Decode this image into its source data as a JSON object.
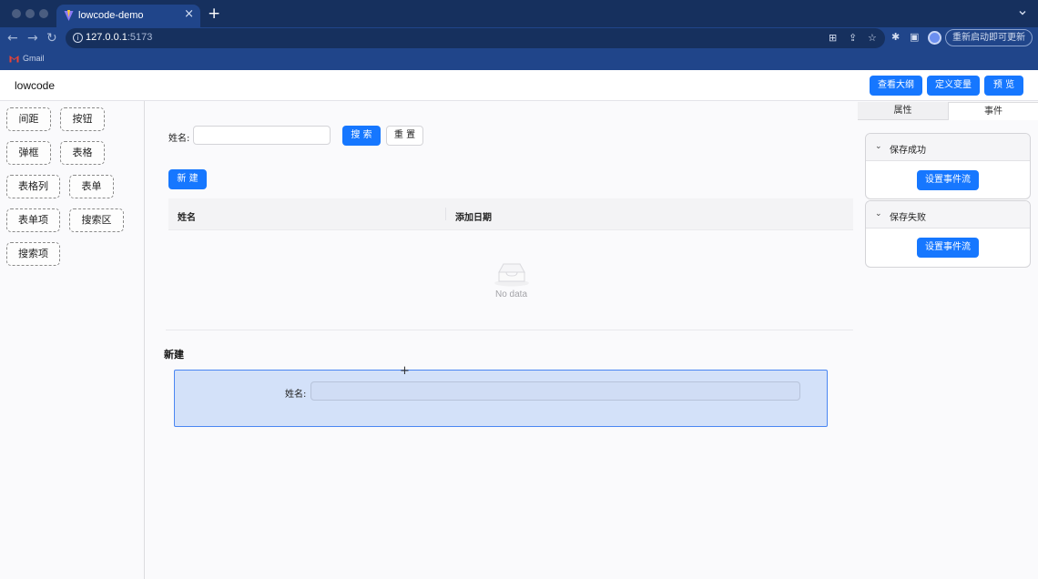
{
  "browser": {
    "tab_title": "lowcode-demo",
    "tab_close": "×",
    "new_tab": "+",
    "url_host": "127.0.0.1",
    "url_port": ":5173",
    "update_button": "重新启动即可更新",
    "bookmark": "Gmail",
    "icons": [
      "back-arrow-icon",
      "forward-arrow-icon",
      "reload-icon",
      "site-info-icon",
      "translate-icon",
      "share-icon",
      "star-icon",
      "extensions-icon",
      "sidepanel-icon",
      "profile-icon"
    ]
  },
  "header": {
    "logo": "lowcode",
    "buttons": [
      "查看大纲",
      "定义变量",
      "预 览"
    ]
  },
  "components": {
    "items": [
      "间距",
      "按钮",
      "弹框",
      "表格",
      "表格列",
      "表单",
      "表单项",
      "搜索区",
      "搜索项"
    ]
  },
  "canvas": {
    "search_label": "姓名:",
    "search_button": "搜 索",
    "reset_button": "重 置",
    "new_button": "新 建",
    "table_columns": [
      "姓名",
      "添加日期"
    ],
    "empty_text": "No data",
    "modal_title": "新建",
    "form_label": "姓名:",
    "crosshair": "+"
  },
  "right_panel": {
    "tabs": [
      "属性",
      "事件"
    ],
    "active_tab": "事件",
    "events": [
      {
        "title": "保存成功",
        "button": "设置事件流"
      },
      {
        "title": "保存失败",
        "button": "设置事件流"
      }
    ],
    "chevron": "⌄"
  },
  "colors": {
    "primary": "#1677ff",
    "chrome_dark": "#16305e",
    "chrome": "#20458a",
    "drop_highlight": "#d3e1f9"
  }
}
